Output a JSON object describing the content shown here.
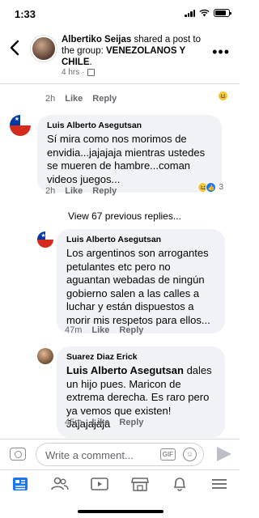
{
  "status": {
    "time": "1:33"
  },
  "header": {
    "author": "Albertiko Seijas",
    "action": " shared a post to the group: ",
    "group": "VENEZOLANOS Y CHILE",
    "period": ".",
    "meta_time": "4 hrs",
    "meta_separator": "·"
  },
  "first_actions": {
    "time": "2h",
    "like": "Like",
    "reply": "Reply"
  },
  "comments": [
    {
      "name": "Luis Alberto Asegutsan",
      "text": "Sí mira como nos morimos de envidia...jajajaja mientras ustedes se mueren de hambre...coman videos juegos...",
      "time": "2h",
      "like": "Like",
      "reply": "Reply",
      "reaction_count": "3"
    },
    {
      "name": "Luis Alberto Asegutsan",
      "text": "Los argentinos son arrogantes petulantes etc pero no aguantan webadas de ningún gobierno salen a las calles a luchar y están dispuestos a morir mis respetos para ellos...",
      "time": "47m",
      "like": "Like",
      "reply": "Reply"
    },
    {
      "name": "Suarez Diaz Erick",
      "mention": "Luis Alberto Asegutsan",
      "text": " dales un hijo pues. Maricon de extrema derecha. Es raro pero ya vemos que existen! Jajajajaja",
      "time": "45m",
      "like": "Like",
      "reply": "Reply"
    }
  ],
  "view_previous": "View 67 previous replies...",
  "composer": {
    "placeholder": "Write a comment...",
    "gif": "GIF"
  },
  "icons": [
    "back-arrow-icon",
    "more-icon",
    "camera-icon",
    "gif-icon",
    "emoji-icon",
    "send-icon",
    "news-feed-icon",
    "friends-icon",
    "watch-icon",
    "marketplace-icon",
    "notifications-icon",
    "menu-icon"
  ],
  "colors": {
    "accent": "#1877f2",
    "bubble": "#f0f2f5",
    "muted": "#65676b"
  }
}
